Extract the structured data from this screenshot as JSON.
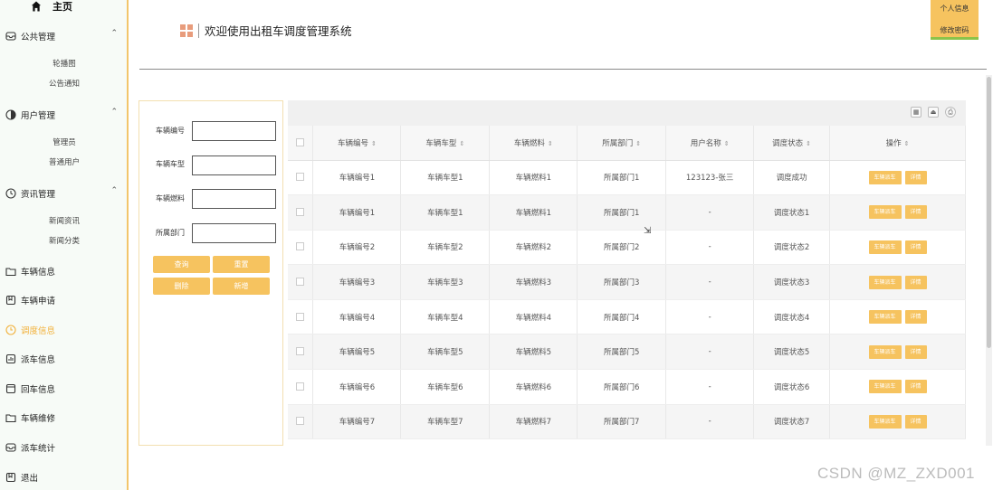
{
  "sidebar": {
    "home_label": "主页",
    "groups": [
      {
        "label": "公共管理",
        "icon": "inbox-icon",
        "items": [
          "轮播图",
          "公告通知"
        ]
      },
      {
        "label": "用户管理",
        "icon": "user-circle-icon",
        "items": [
          "管理员",
          "普通用户"
        ]
      },
      {
        "label": "资讯管理",
        "icon": "clock-icon",
        "items": [
          "新闻资讯",
          "新闻分类"
        ]
      }
    ],
    "items": [
      {
        "label": "车辆信息",
        "icon": "folder-icon"
      },
      {
        "label": "车辆申请",
        "icon": "bookmark-icon"
      },
      {
        "label": "调度信息",
        "icon": "timer-icon",
        "active": true
      },
      {
        "label": "派车信息",
        "icon": "chart-icon"
      },
      {
        "label": "回车信息",
        "icon": "browser-icon"
      },
      {
        "label": "车辆维修",
        "icon": "folder-icon"
      },
      {
        "label": "派车统计",
        "icon": "inbox-icon"
      },
      {
        "label": "退出",
        "icon": "bookmark-icon"
      }
    ]
  },
  "header": {
    "title": "欢迎使用出租车调度管理系统",
    "user_menu": [
      "个人信息",
      "修改密码"
    ]
  },
  "search": {
    "fields": [
      "车辆编号",
      "车辆车型",
      "车辆燃料",
      "所属部门"
    ],
    "buttons": [
      "查询",
      "重置",
      "删除",
      "新增"
    ]
  },
  "table": {
    "columns": [
      "车辆编号",
      "车辆车型",
      "车辆燃料",
      "所属部门",
      "用户名称",
      "调度状态",
      "操作"
    ],
    "rows": [
      [
        "车辆编号1",
        "车辆车型1",
        "车辆燃料1",
        "所属部门1",
        "123123-张三",
        "调度成功"
      ],
      [
        "车辆编号1",
        "车辆车型1",
        "车辆燃料1",
        "所属部门1",
        "-",
        "调度状态1"
      ],
      [
        "车辆编号2",
        "车辆车型2",
        "车辆燃料2",
        "所属部门2",
        "-",
        "调度状态2"
      ],
      [
        "车辆编号3",
        "车辆车型3",
        "车辆燃料3",
        "所属部门3",
        "-",
        "调度状态3"
      ],
      [
        "车辆编号4",
        "车辆车型4",
        "车辆燃料4",
        "所属部门4",
        "-",
        "调度状态4"
      ],
      [
        "车辆编号5",
        "车辆车型5",
        "车辆燃料5",
        "所属部门5",
        "-",
        "调度状态5"
      ],
      [
        "车辆编号6",
        "车辆车型6",
        "车辆燃料6",
        "所属部门6",
        "-",
        "调度状态6"
      ],
      [
        "车辆编号7",
        "车辆车型7",
        "车辆燃料7",
        "所属部门7",
        "-",
        "调度状态7"
      ]
    ],
    "op_buttons": [
      "车辆派车",
      "详情"
    ],
    "toolbar_icons": [
      "columns-icon",
      "export-icon",
      "print-icon"
    ]
  },
  "watermark": "CSDN @MZ_ZXD001",
  "colors": {
    "accent": "#f6c35f",
    "sidebar_bg": "#f7fbf7",
    "active_text": "#f2b13b",
    "title_icon": "#e89c7c"
  }
}
